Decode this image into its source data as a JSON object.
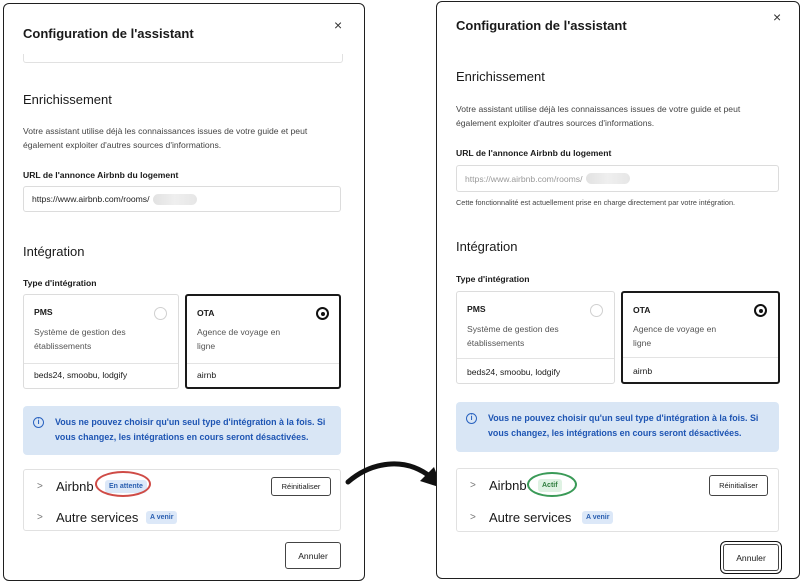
{
  "dialog": {
    "title": "Configuration de l'assistant",
    "close_symbol": "×"
  },
  "enrichment": {
    "heading": "Enrichissement",
    "description": "Votre assistant utilise déjà les connaissances issues de votre guide et peut également exploiter d'autres sources d'informations.",
    "url_label": "URL de l'annonce Airbnb du logement",
    "url_value": "https://www.airbnb.com/rooms/",
    "url_help": "Cette fonctionnalité est actuellement prise en charge directement par votre intégration."
  },
  "integration": {
    "heading": "Intégration",
    "type_label": "Type d'intégration",
    "options": [
      {
        "title": "PMS",
        "description": "Système de gestion des établissements",
        "providers": "beds24, smoobu, lodgify",
        "selected": false
      },
      {
        "title": "OTA",
        "description": "Agence de voyage en ligne",
        "providers": "airnb",
        "selected": true
      }
    ],
    "alert": "Vous ne pouvez choisir qu'un seul type d'intégration à la fois. Si vous changez, les intégrations en cours seront désactivées.",
    "alert_icon": "info-icon"
  },
  "services_before": {
    "airbnb": {
      "name": "Airbnb",
      "status": "En attente",
      "reset_label": "Réinitialiser"
    },
    "other": {
      "name": "Autre services",
      "badge": "A venir"
    }
  },
  "services_after": {
    "airbnb": {
      "name": "Airbnb",
      "status": "Actif",
      "reset_label": "Réinitialiser"
    },
    "other": {
      "name": "Autre services",
      "badge": "A venir"
    }
  },
  "footer": {
    "cancel_label": "Annuler"
  },
  "colors": {
    "info_bg": "#d9e6f5",
    "info_text": "#1e55b3",
    "pending_ring": "#cf4b46",
    "active_ring": "#3a9a57"
  }
}
